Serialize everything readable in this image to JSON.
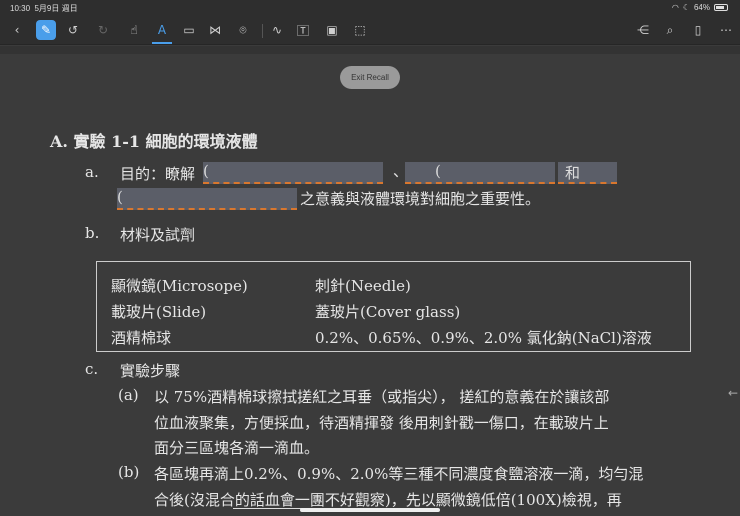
{
  "status": {
    "time": "10:30",
    "date": "5月9日 週日",
    "battery": "64%",
    "battery_level": 0.64
  },
  "toolbar": {
    "exit_recall": "Exit Recall"
  },
  "doc": {
    "title": "A. 實驗 1-1  細胞的環境液體",
    "a_label": "a.",
    "a_text": "目的：瞭解",
    "a_blank1": "    (",
    "a_sep": "、",
    "a_blank2": "(",
    "a_he": "和",
    "a_blank3": "(",
    "a_rest": "之意義與液體環境對細胞之重要性。",
    "b_label": "b.",
    "b_text": "材料及試劑",
    "materials": [
      [
        "顯微鏡(Microsope)",
        "刺針(Needle)"
      ],
      [
        "載玻片(Slide)",
        "蓋玻片(Cover glass)"
      ],
      [
        "酒精棉球",
        "0.2%、0.65%、0.9%、2.0%  氯化鈉(NaCl)溶液"
      ]
    ],
    "c_label": "c.",
    "c_text": "實驗步驟",
    "step_a_label": "(a)",
    "step_a_lines": [
      "以 75%酒精棉球擦拭搓紅之耳垂（或指尖），  搓紅的意義在於讓該部",
      "位血液聚集，方便採血，待酒精揮發  後用刺針戳一傷口，在載玻片上",
      "面分三區塊各滴一滴血。"
    ],
    "step_b_label": "(b)",
    "step_b_lines": [
      "各區塊再滴上0.2%、0.9%、2.0%等三種不同濃度食鹽溶液一滴，均勻混",
      "合後(沒混合的話血會一團不好觀察)，先以顯微鏡低倍(100X)檢視，再"
    ]
  }
}
